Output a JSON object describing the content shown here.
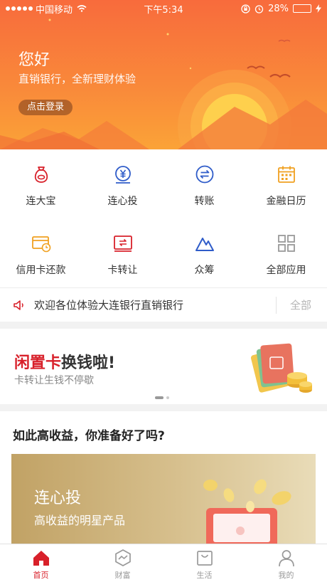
{
  "status_bar": {
    "carrier": "中国移动",
    "time": "下午5:34",
    "battery": "28%",
    "battery_level": 0.28
  },
  "hero": {
    "greeting": "您好",
    "subtitle": "直销银行，全新理财体验",
    "login_label": "点击登录"
  },
  "menu": {
    "items": [
      {
        "label": "连大宝",
        "icon": "money-bag-icon"
      },
      {
        "label": "连心投",
        "icon": "yen-coin-icon"
      },
      {
        "label": "转账",
        "icon": "transfer-icon"
      },
      {
        "label": "金融日历",
        "icon": "calendar-icon"
      },
      {
        "label": "信用卡还款",
        "icon": "credit-card-clock-icon"
      },
      {
        "label": "卡转让",
        "icon": "card-swap-icon"
      },
      {
        "label": "众筹",
        "icon": "mountain-icon"
      },
      {
        "label": "全部应用",
        "icon": "grid-apps-icon"
      }
    ]
  },
  "notice": {
    "text": "欢迎各位体验大连银行直销银行",
    "all_label": "全部"
  },
  "banner": {
    "title_highlight": "闲置卡",
    "title_rest": "换钱啦!",
    "subtitle": "卡转让生钱不停歇"
  },
  "section": {
    "heading": "如此高收益，你准备好了吗?",
    "card_title": "连心投",
    "card_desc": "高收益的明星产品"
  },
  "tabbar": {
    "tabs": [
      {
        "label": "首页",
        "icon": "home-icon"
      },
      {
        "label": "财富",
        "icon": "wealth-icon"
      },
      {
        "label": "生活",
        "icon": "shopping-bag-icon"
      },
      {
        "label": "我的",
        "icon": "user-icon"
      }
    ]
  },
  "colors": {
    "accent_red": "#d8202a",
    "hero_orange": "#f98a3a",
    "card_gold": "#c1a265"
  }
}
